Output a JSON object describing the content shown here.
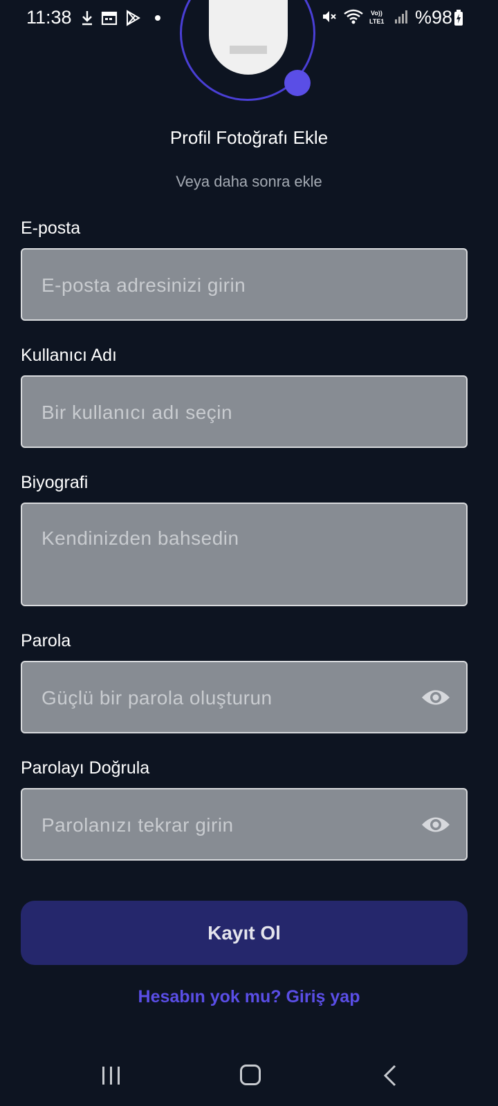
{
  "status_bar": {
    "time": "11:38",
    "battery_text": "%98",
    "left_icons": [
      "download-icon",
      "calendar-icon",
      "play-store-icon",
      "notification-dot-icon"
    ],
    "right_icons": [
      "mute-icon",
      "wifi-icon",
      "volte-lte-icon",
      "signal-icon",
      "battery-charging-icon"
    ]
  },
  "profile": {
    "add_photo_label": "Profil Fotoğrafı Ekle",
    "add_later_label": "Veya daha sonra ekle",
    "accent_color": "#5a4ee6"
  },
  "form": {
    "email": {
      "label": "E-posta",
      "placeholder": "E-posta adresinizi girin",
      "value": ""
    },
    "username": {
      "label": "Kullanıcı Adı",
      "placeholder": "Bir kullanıcı adı seçin",
      "value": ""
    },
    "bio": {
      "label": "Biyografi",
      "placeholder": "Kendinizden bahsedin",
      "value": ""
    },
    "password": {
      "label": "Parola",
      "placeholder": "Güçlü bir parola oluşturun",
      "value": ""
    },
    "confirm_password": {
      "label": "Parolayı Doğrula",
      "placeholder": "Parolanızı tekrar girin",
      "value": ""
    }
  },
  "actions": {
    "register_label": "Kayıt Ol",
    "login_link": "Hesabın yok mu? Giriş yap",
    "button_color": "#25276c"
  },
  "nav_bar": {
    "icons": [
      "recent-apps-icon",
      "home-icon",
      "back-icon"
    ]
  }
}
